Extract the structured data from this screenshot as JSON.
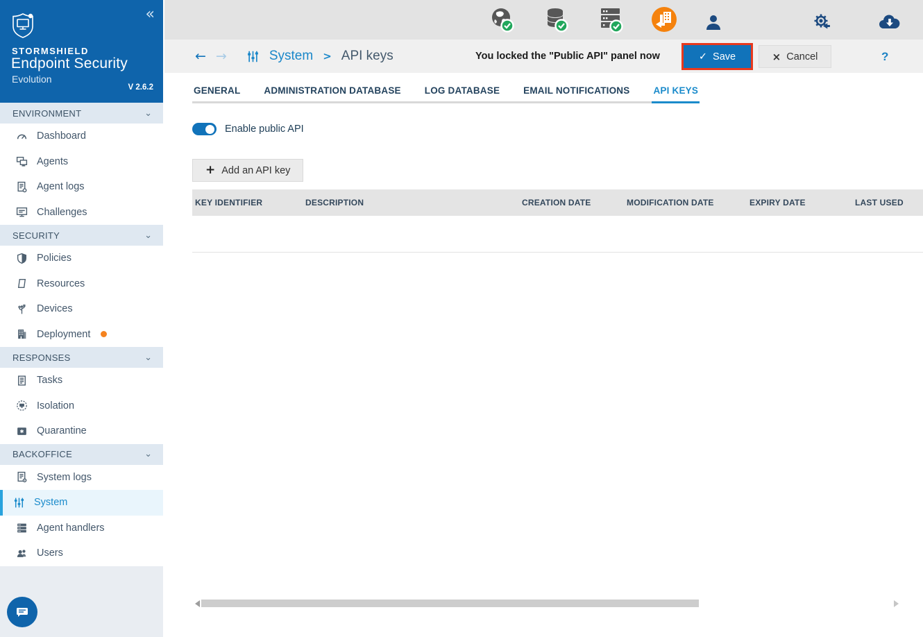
{
  "app": {
    "brand": "STORMSHIELD",
    "product": "Endpoint Security",
    "edition": "Evolution",
    "version": "V 2.6.2"
  },
  "icons": {
    "collapse": "«",
    "back_arrow": "←",
    "forward_arrow": "→",
    "breadcrumb_separator": ">",
    "chevron_down": "⌄",
    "check": "✓",
    "close": "×",
    "plus": "+",
    "help": "?"
  },
  "sidebar": {
    "sections": [
      {
        "label": "ENVIRONMENT",
        "items": [
          {
            "label": "Dashboard"
          },
          {
            "label": "Agents"
          },
          {
            "label": "Agent logs"
          },
          {
            "label": "Challenges"
          }
        ]
      },
      {
        "label": "SECURITY",
        "items": [
          {
            "label": "Policies"
          },
          {
            "label": "Resources"
          },
          {
            "label": "Devices"
          },
          {
            "label": "Deployment",
            "badge": "orange-dot"
          }
        ]
      },
      {
        "label": "RESPONSES",
        "items": [
          {
            "label": "Tasks"
          },
          {
            "label": "Isolation"
          },
          {
            "label": "Quarantine"
          }
        ]
      },
      {
        "label": "BACKOFFICE",
        "items": [
          {
            "label": "System logs"
          },
          {
            "label": "System",
            "active": true
          },
          {
            "label": "Agent handlers"
          },
          {
            "label": "Users"
          }
        ]
      }
    ]
  },
  "topbar": {
    "status_icons": [
      {
        "name": "internet-status",
        "state": "ok"
      },
      {
        "name": "database-status",
        "state": "ok"
      },
      {
        "name": "agent-handler-status",
        "state": "ok"
      },
      {
        "name": "deployment-sync-status",
        "state": "attention"
      }
    ],
    "right_icons": [
      {
        "name": "user-account"
      },
      {
        "name": "external-services"
      },
      {
        "name": "cloud-download"
      }
    ]
  },
  "actionbar": {
    "breadcrumb": {
      "parent": "System",
      "current": "API keys"
    },
    "notification": "You locked the \"Public API\" panel now",
    "save_label": "Save",
    "cancel_label": "Cancel"
  },
  "tabs": [
    {
      "label": "GENERAL"
    },
    {
      "label": "ADMINISTRATION DATABASE"
    },
    {
      "label": "LOG DATABASE"
    },
    {
      "label": "EMAIL NOTIFICATIONS"
    },
    {
      "label": "API KEYS",
      "active": true
    }
  ],
  "panel": {
    "toggle_label": "Enable public API",
    "toggle_on": true,
    "add_button_label": "Add an API key"
  },
  "table": {
    "columns": [
      "KEY IDENTIFIER",
      "DESCRIPTION",
      "CREATION DATE",
      "MODIFICATION DATE",
      "EXPIRY DATE",
      "LAST USED"
    ],
    "rows": []
  },
  "colors": {
    "sidebar_header": "#0f64ab",
    "accent_blue": "#1b8bcb",
    "active_bar": "#29a3dd",
    "save_button": "#1173ba",
    "annotation_highlight": "#e8391d",
    "status_ok": "#21a75c",
    "sync_orange": "#f5820d",
    "badge_orange": "#f5831f"
  }
}
